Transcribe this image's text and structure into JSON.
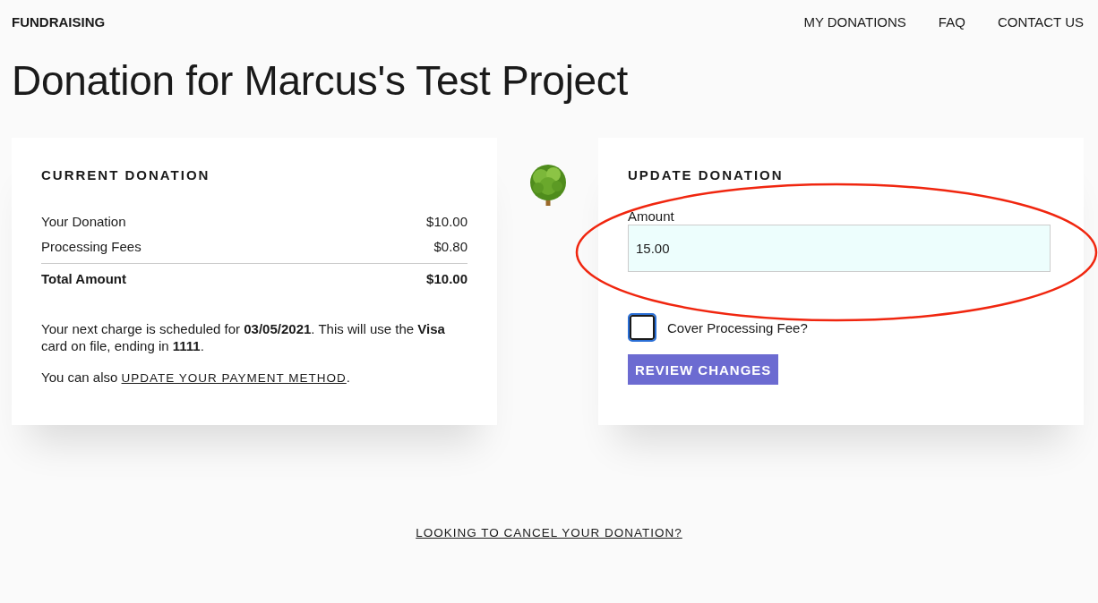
{
  "header": {
    "brand": "FUNDRAISING",
    "nav": [
      "MY DONATIONS",
      "FAQ",
      "CONTACT US"
    ]
  },
  "title": "Donation for Marcus's Test Project",
  "current_donation": {
    "heading": "CURRENT DONATION",
    "rows": [
      {
        "label": "Your Donation",
        "value": "$10.00",
        "kind": "item"
      },
      {
        "label": "Processing Fees",
        "value": "$0.80",
        "kind": "item"
      },
      {
        "label": "Total Amount",
        "value": "$10.00",
        "kind": "total"
      }
    ],
    "schedule_note": "Your next charge is scheduled for **03/05/2021**. This will use the **Visa** card on file, ending in **1111**.",
    "payment_note": {
      "before": "You can also ",
      "link": "UPDATE YOUR PAYMENT METHOD",
      "after": "."
    }
  },
  "update_donation": {
    "heading": "UPDATE DONATION",
    "amount": {
      "label": "Amount",
      "value": "15.00"
    },
    "cover_fee": {
      "label": "Cover Processing Fee?",
      "checked": false
    },
    "button": "REVIEW CHANGES"
  },
  "cancel_link": "LOOKING TO CANCEL YOUR DONATION?"
}
